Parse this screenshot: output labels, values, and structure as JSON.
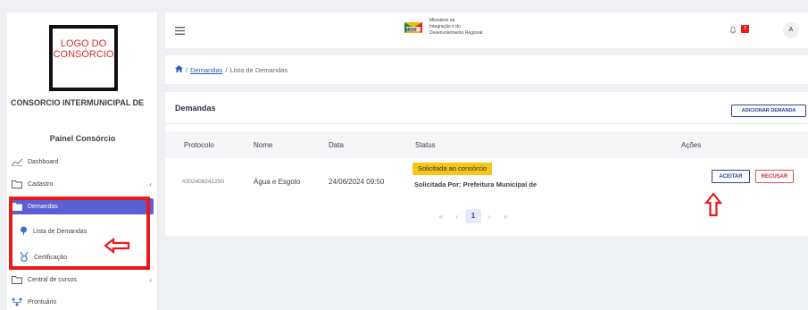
{
  "sidebar": {
    "logo_text": "LOGO DO CONSÓRCIO",
    "org_name": "CONSORCIO INTERMUNICIPAL DE",
    "panel_title": "Painel Consórcio",
    "items": [
      {
        "label": "Dashboard",
        "icon": "chart-line-icon"
      },
      {
        "label": "Cadastro",
        "icon": "folder-icon",
        "chevron": "‹"
      },
      {
        "label": "Demandas",
        "icon": "folder-open-icon",
        "chevron": "⌄"
      },
      {
        "label": "Central de cursos",
        "icon": "folder-icon",
        "chevron": "‹"
      },
      {
        "label": "Prontuário",
        "icon": "network-icon"
      }
    ],
    "subitems": [
      {
        "label": "Lista de Demandas",
        "icon": "pin-icon"
      },
      {
        "label": "Certificação",
        "icon": "medal-icon"
      }
    ]
  },
  "header": {
    "gov_line1": "Ministério da",
    "gov_line2": "Integração e do",
    "gov_line3": "Desenvolvimento Regional",
    "gov_abbr": "MIDR",
    "notif_count": "2",
    "avatar": "A"
  },
  "breadcrumb": {
    "link": "Demandas",
    "separator1": "/",
    "separator2": "/",
    "current": "Lista de Demandas"
  },
  "card": {
    "title": "Demandas",
    "add_button": "ADICIONAR DEMANDA",
    "columns": [
      "Protocolo",
      "Nome",
      "Data",
      "Status",
      "Ações"
    ],
    "rows": [
      {
        "protocolo": "#202406241250",
        "nome": "Água e Esgoto",
        "data": "24/06/2024 09:50",
        "status": "Solicitada ao consórcio",
        "solicitada_por": "Solicitada Por: Prefeitura Municipal de",
        "accept": "ACEITAR",
        "reject": "RECUSAR"
      }
    ],
    "pager": {
      "first": "«",
      "prev": "‹",
      "current": "1",
      "next": "›",
      "last": "»"
    }
  },
  "colors": {
    "accent": "#5a5fd6",
    "primary": "#2e3f9c",
    "status_yellow": "#f5c518",
    "highlight_red": "#e81b1b"
  }
}
